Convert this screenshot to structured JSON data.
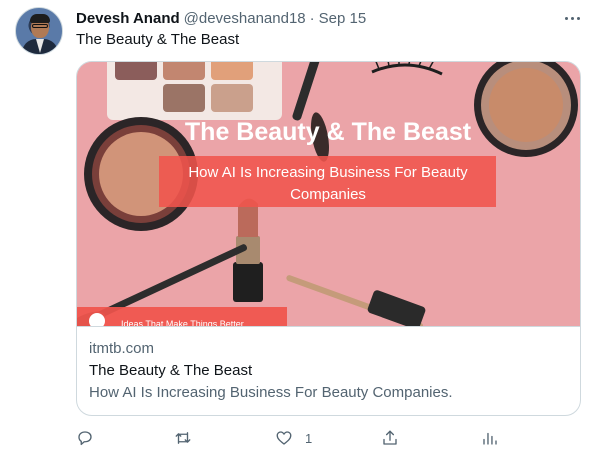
{
  "tweet": {
    "author_name": "Devesh Anand",
    "handle": "@deveshanand18",
    "separator": "·",
    "date": "Sep 15",
    "text": "The Beauty & The Beast",
    "more_icon": "more-horizontal-icon"
  },
  "card": {
    "image": {
      "headline": "The Beauty & The Beast",
      "subline_1": "How AI Is Increasing Business For Beauty",
      "subline_2": "Companies",
      "brand_tagline": "Ideas That Make Things Better",
      "banner_color": "#f0544c"
    },
    "domain": "itmtb.com",
    "title": "The Beauty & The Beast",
    "description": "How AI Is Increasing Business For Beauty Companies."
  },
  "actions": {
    "reply_icon": "reply-icon",
    "retweet_icon": "retweet-icon",
    "like_icon": "heart-icon",
    "like_count": "1",
    "share_icon": "share-icon",
    "analytics_icon": "analytics-icon"
  },
  "colors": {
    "text_primary": "#0f1419",
    "text_secondary": "#536471",
    "border": "#cfd9de",
    "image_background": "#eba4a8"
  }
}
